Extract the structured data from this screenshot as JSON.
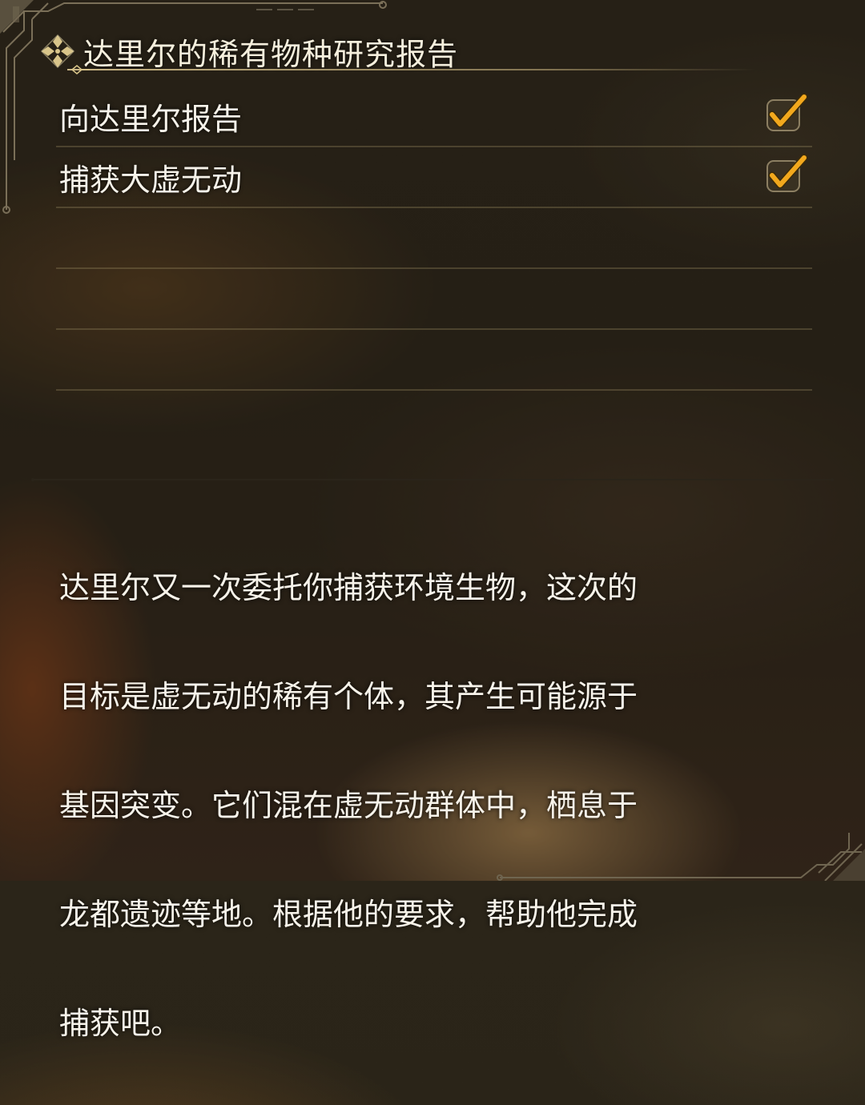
{
  "quest": {
    "title": "达里尔的稀有物种研究报告",
    "title_icon": "ornate-diamond-icon"
  },
  "objectives": [
    {
      "label": "向达里尔报告",
      "completed": true,
      "status_icon": "checkmark-icon"
    },
    {
      "label": "捕获大虚无动",
      "completed": true,
      "status_icon": "checkmark-icon"
    }
  ],
  "empty_slots": 4,
  "description": {
    "lines": [
      "达里尔又一次委托你捕获环境生物，这次的",
      "目标是虚无动的稀有个体，其产生可能源于",
      "基因突变。它们混在虚无动群体中，栖息于",
      "龙都遗迹等地。根据他的要求，帮助他完成",
      "捕获吧。"
    ]
  },
  "colors": {
    "accent_gold": "#d9c58a",
    "check_orange": "#f2a81d",
    "text": "#f7f3ea",
    "line": "#968760"
  }
}
